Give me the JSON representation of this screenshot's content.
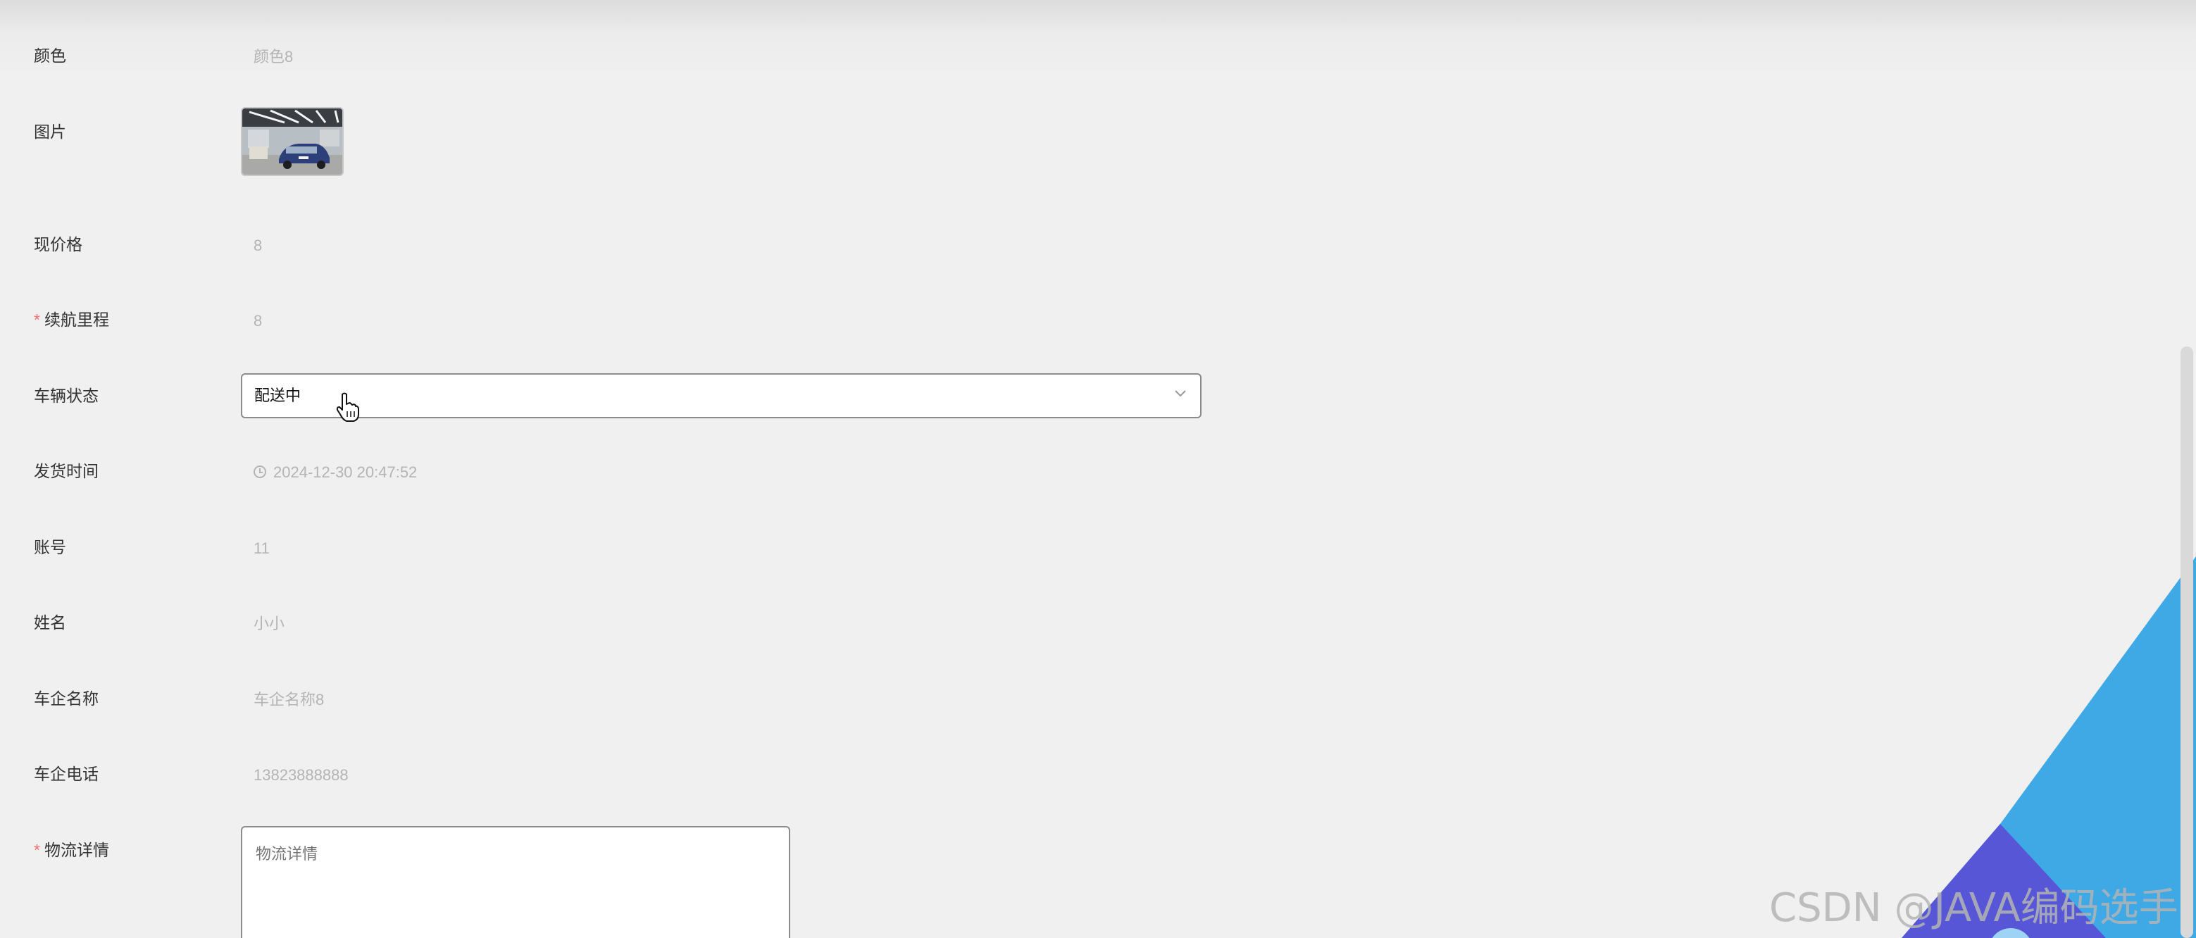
{
  "form": {
    "color": {
      "label": "颜色",
      "value": "颜色8"
    },
    "image": {
      "label": "图片"
    },
    "current_price": {
      "label": "现价格",
      "value": "8"
    },
    "range": {
      "required_mark": "*",
      "label": "续航里程",
      "value": "8"
    },
    "vehicle_status": {
      "label": "车辆状态",
      "selected": "配送中"
    },
    "ship_time": {
      "label": "发货时间",
      "value": "2024-12-30 20:47:52"
    },
    "account": {
      "label": "账号",
      "value": "11"
    },
    "name": {
      "label": "姓名",
      "value": "小小"
    },
    "company_name": {
      "label": "车企名称",
      "value": "车企名称8"
    },
    "company_phone": {
      "label": "车企电话",
      "value": "13823888888"
    },
    "logistics": {
      "required_mark": "*",
      "label": "物流详情",
      "placeholder": "物流详情"
    }
  },
  "watermark": "CSDN @JAVA编码选手",
  "colors": {
    "background": "#f0f0f0",
    "label": "#333333",
    "value_muted": "#b4b4b4",
    "required": "#f56c6c",
    "deco_light_blue": "#3fa9e6",
    "deco_purple": "#5656d6"
  }
}
